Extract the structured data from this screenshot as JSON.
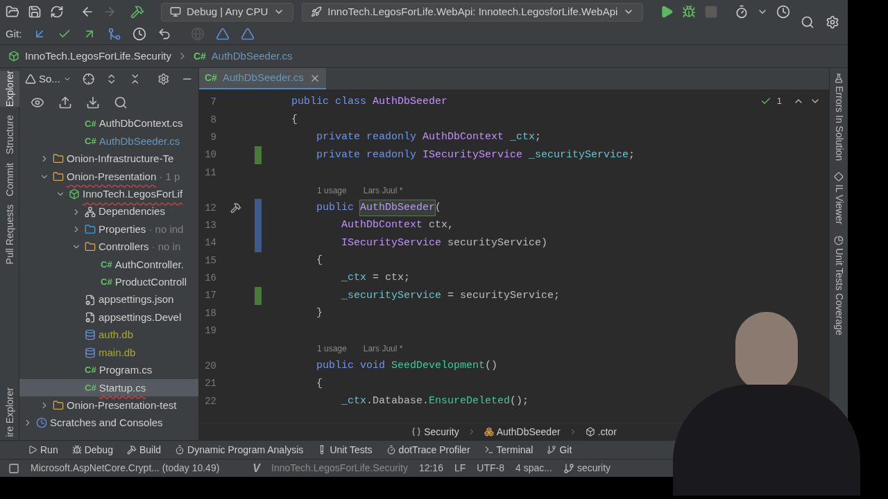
{
  "toolbar": {
    "config": "Debug | Any CPU",
    "run_config": "InnoTech.LegosForLife.WebApi: Innotech.LegosforLife.WebApi"
  },
  "git_bar": {
    "label": "Git:"
  },
  "breadcrumb": {
    "project": "InnoTech.LegosForLife.Security",
    "file_badge": "C#",
    "file": "AuthDbSeeder.cs"
  },
  "left_strip": {
    "top": [
      {
        "label": "Explorer",
        "selected": true
      },
      {
        "label": "Structure",
        "selected": false
      },
      {
        "label": "Commit",
        "selected": false
      },
      {
        "label": "Pull Requests",
        "selected": false
      }
    ],
    "bottom": [
      {
        "label": "ire Explorer",
        "selected": false
      }
    ]
  },
  "project_panel": {
    "view": "So...",
    "tree_continued": [
      {
        "label": "AuthDbContext.cs",
        "kind": "cs",
        "badge": "C#",
        "color": "#d0d0d0",
        "error": false,
        "selected": false
      },
      {
        "label": "AuthDbSeeder.cs",
        "kind": "cs",
        "badge": "C#",
        "color": "#6897bb",
        "error": false,
        "selected": false
      }
    ],
    "tree": [
      {
        "label": "Onion-Infrastructure-Te",
        "kind": "solution-folder",
        "color": "#d0d0d0",
        "error": false,
        "selected": false,
        "expanded": false
      },
      {
        "label": "Onion-Presentation",
        "suffix": "· 1 p",
        "kind": "solution-folder",
        "color": "#d0d0d0",
        "error": true,
        "selected": false,
        "expanded": true,
        "children": [
          {
            "label": "InnoTech.LegosForLif",
            "kind": "project",
            "color": "#d0d0d0",
            "error": true,
            "selected": false,
            "expanded": true,
            "children": [
              {
                "label": "Dependencies",
                "kind": "dependencies",
                "color": "#d0d0d0",
                "error": false,
                "selected": false,
                "expanded": false
              },
              {
                "label": "Properties",
                "suffix": "· no ind",
                "kind": "properties",
                "color": "#d0d0d0",
                "error": false,
                "selected": false,
                "expanded": false
              },
              {
                "label": "Controllers",
                "suffix": "· no in",
                "kind": "folder",
                "color": "#d0d0d0",
                "error": false,
                "selected": false,
                "expanded": true,
                "children": [
                  {
                    "label": "AuthController.",
                    "kind": "cs",
                    "badge": "C#",
                    "color": "#d0d0d0",
                    "error": false,
                    "selected": false
                  },
                  {
                    "label": "ProductControll",
                    "kind": "cs",
                    "badge": "C#",
                    "color": "#d0d0d0",
                    "error": false,
                    "selected": false
                  }
                ]
              },
              {
                "label": "appsettings.json",
                "kind": "settings-file",
                "color": "#d0d0d0",
                "error": false,
                "selected": false
              },
              {
                "label": "appsettings.Devel",
                "kind": "settings-file",
                "color": "#d0d0d0",
                "error": false,
                "selected": false
              },
              {
                "label": "auth.db",
                "kind": "database",
                "color": "#a8a832",
                "error": false,
                "selected": false
              },
              {
                "label": "main.db",
                "kind": "database",
                "color": "#a8a832",
                "error": false,
                "selected": false
              },
              {
                "label": "Program.cs",
                "kind": "cs",
                "badge": "C#",
                "color": "#d0d0d0",
                "error": false,
                "selected": false
              },
              {
                "label": "Startup.cs",
                "kind": "cs",
                "badge": "C#",
                "color": "#d0d0d0",
                "error": true,
                "selected": true
              }
            ]
          }
        ]
      },
      {
        "label": "Onion-Presentation-test",
        "kind": "solution-folder",
        "color": "#d0d0d0",
        "error": false,
        "selected": false,
        "expanded": false
      },
      {
        "label": "Scratches and Consoles",
        "kind": "scratches",
        "color": "#d0d0d0",
        "error": false,
        "selected": false,
        "expanded": false
      }
    ]
  },
  "editor": {
    "tabs": [
      {
        "badge": "C#",
        "label": "AuthDbSeeder.cs",
        "selected": true
      }
    ],
    "inspection": {
      "count": "1"
    },
    "lines": [
      {
        "kind": "code",
        "number": "7",
        "tokens": [
          {
            "t": "public class ",
            "kind": "kw"
          },
          {
            "t": "AuthDbSeeder",
            "kind": "type"
          }
        ]
      },
      {
        "kind": "code",
        "number": "8",
        "tokens": [
          {
            "t": "{",
            "kind": "plain"
          }
        ]
      },
      {
        "kind": "code",
        "number": "9",
        "tokens": [
          {
            "t": "    private readonly ",
            "kind": "kw"
          },
          {
            "t": "AuthDbContext ",
            "kind": "type"
          },
          {
            "t": "_ctx",
            "kind": "field"
          },
          {
            "t": ";",
            "kind": "plain"
          }
        ]
      },
      {
        "kind": "code",
        "number": "10",
        "color": "#4a7a3a",
        "tokens": [
          {
            "t": "    private readonly ",
            "kind": "kw"
          },
          {
            "t": "ISecurityService ",
            "kind": "type"
          },
          {
            "t": "_securityService",
            "kind": "field"
          },
          {
            "t": ";",
            "kind": "plain"
          }
        ]
      },
      {
        "kind": "code",
        "number": "11"
      },
      {
        "kind": "hint",
        "usages": "1 usage",
        "author": "Lars Juul *"
      },
      {
        "kind": "code",
        "number": "12",
        "color": "#3d5a8a",
        "marker": true,
        "tokens": [
          {
            "t": "    public ",
            "kind": "kw"
          },
          {
            "t": "AuthDbSeeder",
            "kind": "type",
            "selected": true
          },
          {
            "t": "(",
            "kind": "plain"
          }
        ]
      },
      {
        "kind": "code",
        "number": "13",
        "color": "#3d5a8a",
        "tokens": [
          {
            "t": "        AuthDbContext",
            "kind": "type"
          },
          {
            "t": " ctx,",
            "kind": "plain"
          }
        ]
      },
      {
        "kind": "code",
        "number": "14",
        "color": "#3d5a8a",
        "tokens": [
          {
            "t": "        ISecurityService",
            "kind": "type"
          },
          {
            "t": " securityService)",
            "kind": "plain"
          }
        ]
      },
      {
        "kind": "code",
        "number": "15",
        "tokens": [
          {
            "t": "    {",
            "kind": "plain"
          }
        ]
      },
      {
        "kind": "code",
        "number": "16",
        "tokens": [
          {
            "t": "        _ctx",
            "kind": "field"
          },
          {
            "t": " = ctx;",
            "kind": "plain"
          }
        ]
      },
      {
        "kind": "code",
        "number": "17",
        "color": "#4a7a3a",
        "tokens": [
          {
            "t": "        _securityService",
            "kind": "field"
          },
          {
            "t": " = securityService;",
            "kind": "plain"
          }
        ]
      },
      {
        "kind": "code",
        "number": "18",
        "tokens": [
          {
            "t": "    }",
            "kind": "plain"
          }
        ]
      },
      {
        "kind": "code",
        "number": "19"
      },
      {
        "kind": "hint",
        "usages": "1 usage",
        "author": "Lars Juul *"
      },
      {
        "kind": "code",
        "number": "20",
        "tokens": [
          {
            "t": "    public void ",
            "kind": "kw"
          },
          {
            "t": "SeedDevelopment",
            "kind": "method"
          },
          {
            "t": "()",
            "kind": "plain"
          }
        ]
      },
      {
        "kind": "code",
        "number": "21",
        "tokens": [
          {
            "t": "    {",
            "kind": "plain"
          }
        ]
      },
      {
        "kind": "code",
        "number": "22",
        "tokens": [
          {
            "t": "        _ctx",
            "kind": "field"
          },
          {
            "t": ".Database.",
            "kind": "plain"
          },
          {
            "t": "EnsureDeleted",
            "kind": "method"
          },
          {
            "t": "();",
            "kind": "plain"
          }
        ]
      }
    ],
    "nav": [
      {
        "label": "Security",
        "kind": "namespace"
      },
      {
        "label": "AuthDbSeeder",
        "kind": "class"
      },
      {
        "label": ".ctor",
        "kind": "ctor"
      }
    ]
  },
  "right_strip": [
    {
      "label": "Errors In Solution",
      "kind": "flask"
    },
    {
      "label": "IL Viewer",
      "kind": "diamonds"
    },
    {
      "label": "Unit Tests Coverage",
      "kind": "coverage"
    }
  ],
  "tool_windows": [
    {
      "label": "Run",
      "kind": "play"
    },
    {
      "label": "Debug",
      "kind": "bug"
    },
    {
      "label": "Build",
      "kind": "hammer"
    },
    {
      "label": "Dynamic Program Analysis",
      "kind": "timer"
    },
    {
      "label": "Unit Tests",
      "kind": "tests"
    },
    {
      "label": "dotTrace Profiler",
      "kind": "timer"
    },
    {
      "label": "Terminal",
      "kind": "terminal"
    },
    {
      "label": "Git",
      "kind": "branch"
    }
  ],
  "status_bar": {
    "message": "Microsoft.AspNetCore.Crypt... (today 10.49)",
    "vcs_logo": "V",
    "project": "InnoTech.LegosForLife.Security",
    "position": "12:16",
    "line_ending": "LF",
    "encoding": "UTF-8",
    "indent": "4 spac...",
    "branch": "security"
  }
}
